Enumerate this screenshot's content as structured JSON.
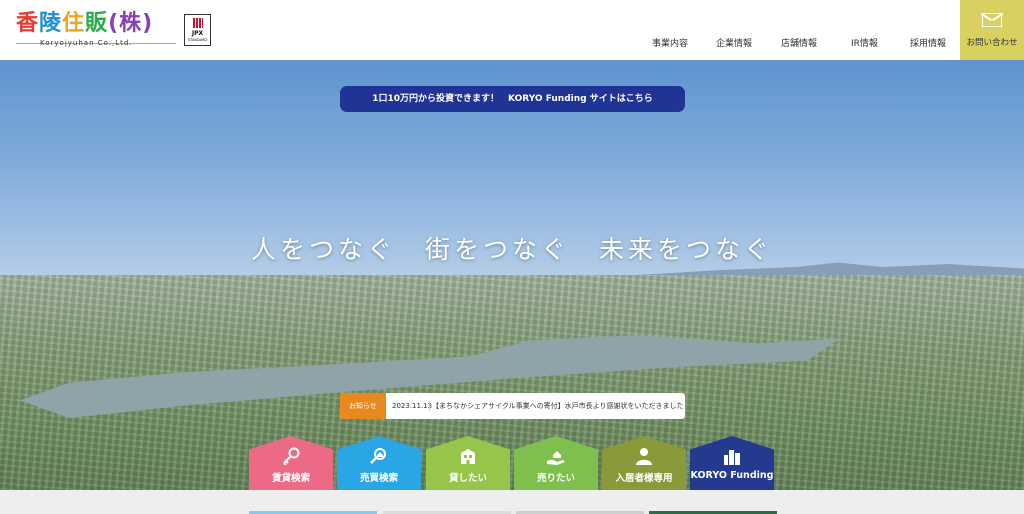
{
  "header": {
    "logo_chars": [
      "香",
      "陵",
      "住",
      "販",
      "(株)"
    ],
    "logo_sub": "Koryojyuhan Co.,Ltd.",
    "jpx_badge": {
      "top": "JPX",
      "bottom": "STANDARD"
    },
    "nav": [
      "事業内容",
      "企業情報",
      "店舗情報",
      "IR情報",
      "採用情報"
    ],
    "contact_label": "お問い合わせ"
  },
  "hero": {
    "funding_banner": "1口10万円から投資できます！　KORYO Funding サイトはこちら",
    "tagline": "人をつなぐ　街をつなぐ　未来をつなぐ",
    "news": {
      "badge": "お知らせ",
      "date": "2023.11.13",
      "text": "【まちなかシェアサイクル事業への寄付】水戸市長より感謝状をいただきました"
    },
    "tiles": [
      {
        "label": "賃貸検索",
        "icon": "key-icon",
        "color": "#ec6a86"
      },
      {
        "label": "売買検索",
        "icon": "house-search-icon",
        "color": "#29a6e3"
      },
      {
        "label": "貸したい",
        "icon": "building-icon",
        "color": "#97c54a"
      },
      {
        "label": "売りたい",
        "icon": "hand-house-icon",
        "color": "#7fbf4d"
      },
      {
        "label": "入居者様専用",
        "icon": "person-icon",
        "color": "#8a9a3a"
      },
      {
        "label": "KORYO Funding",
        "icon": "city-icon",
        "color": "#233a8e"
      }
    ]
  },
  "colors": {
    "accent_yellow": "#d8d061",
    "banner_navy": "#1f3495",
    "news_orange": "#e8891f"
  }
}
